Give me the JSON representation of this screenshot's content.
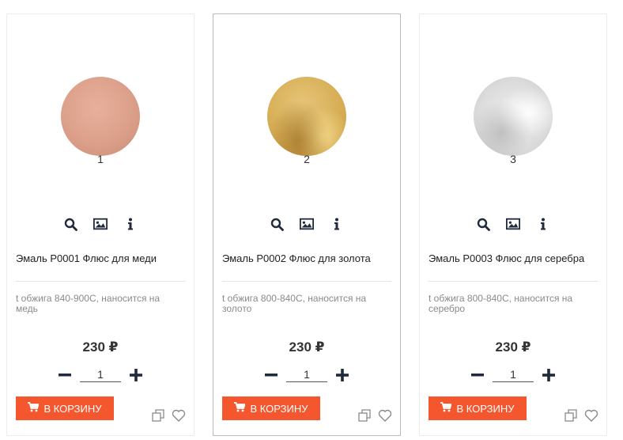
{
  "colors": {
    "accent": "#f4562e",
    "icon": "#1f2a3c"
  },
  "products": [
    {
      "image_color": "copper",
      "image_number": "1",
      "title": "Эмаль P0001 Флюс для меди",
      "desc_line1": "t обжига 840-900С, наносится на",
      "desc_line2": "медь",
      "price": "230 ₽",
      "quantity": "1",
      "cart_label": "В КОРЗИНУ"
    },
    {
      "image_color": "gold",
      "image_number": "2",
      "title": "Эмаль P0002 Флюс для золота",
      "desc_line1": "t обжига 800-840С, наносится на",
      "desc_line2": "золото",
      "price": "230 ₽",
      "quantity": "1",
      "cart_label": "В КОРЗИНУ"
    },
    {
      "image_color": "silver",
      "image_number": "3",
      "title": "Эмаль P0003 Флюс для серебра",
      "desc_line1": "t обжига 800-840С, наносится на",
      "desc_line2": "серебро",
      "price": "230 ₽",
      "quantity": "1",
      "cart_label": "В КОРЗИНУ"
    }
  ],
  "icons": {
    "quick_view": "search-icon",
    "gallery": "image-icon",
    "info": "info-icon",
    "decrease": "minus-icon",
    "increase": "plus-icon",
    "cart": "cart-icon",
    "compare": "compare-icon",
    "favorite": "heart-icon"
  }
}
